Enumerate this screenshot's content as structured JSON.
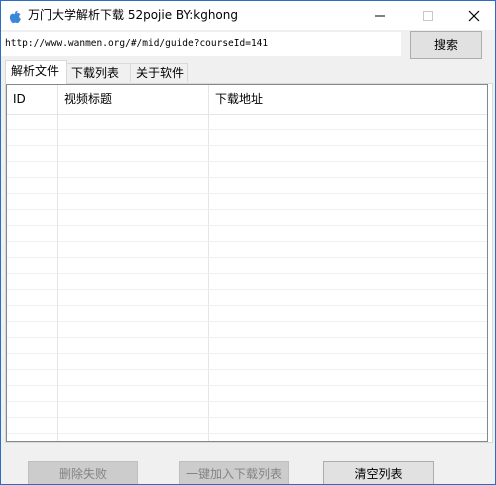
{
  "window": {
    "title": "万门大学解析下载 52pojie BY:kghong",
    "icons": [
      "apple-icon",
      "minimize-icon",
      "maximize-icon",
      "close-icon"
    ]
  },
  "toolbar": {
    "url_value": "http://www.wanmen.org/#/mid/guide?courseId=141",
    "search_label": "搜索"
  },
  "tabs": [
    {
      "label": "解析文件",
      "active": true
    },
    {
      "label": "下载列表",
      "active": false
    },
    {
      "label": "关于软件",
      "active": false
    }
  ],
  "table": {
    "columns": [
      "ID",
      "视频标题",
      "下载地址"
    ],
    "rows": []
  },
  "actions": {
    "delete_failed_label": "删除失败",
    "add_all_label": "一键加入下载列表",
    "clear_list_label": "清空列表"
  },
  "colors": {
    "window_border": "#2b6cc4",
    "button_face": "#e1e1e1",
    "disabled_text": "#838383"
  }
}
